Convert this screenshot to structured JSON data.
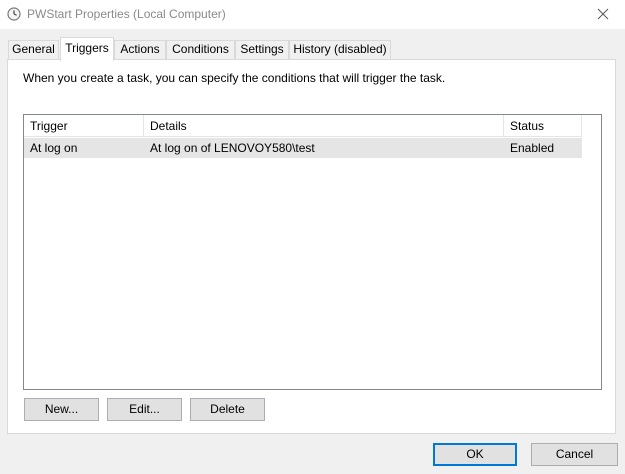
{
  "window": {
    "title": "PWStart Properties (Local Computer)"
  },
  "tabs": [
    {
      "label": "General"
    },
    {
      "label": "Triggers"
    },
    {
      "label": "Actions"
    },
    {
      "label": "Conditions"
    },
    {
      "label": "Settings"
    },
    {
      "label": "History (disabled)"
    }
  ],
  "active_tab": "Triggers",
  "triggers": {
    "description": "When you create a task, you can specify the conditions that will trigger the task.",
    "columns": [
      "Trigger",
      "Details",
      "Status"
    ],
    "rows": [
      {
        "trigger": "At log on",
        "details": "At log on of LENOVOY580\\test",
        "status": "Enabled"
      }
    ],
    "buttons": {
      "new": "New...",
      "edit": "Edit...",
      "delete": "Delete"
    }
  },
  "footer": {
    "ok": "OK",
    "cancel": "Cancel"
  },
  "colors": {
    "accent": "#0078d7",
    "selected_row": "#e5e5e5"
  }
}
